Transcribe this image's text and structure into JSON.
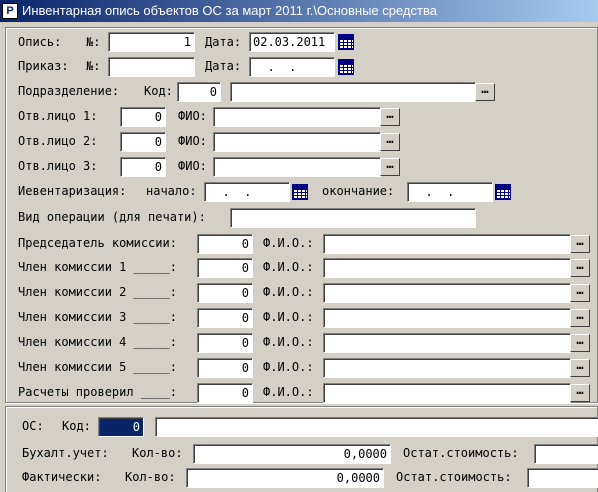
{
  "window": {
    "title": "Инвентарная опись объектов ОС за март 2011 г.\\Основные средства"
  },
  "header": {
    "opis_label": "Опись:",
    "no_label": "№:",
    "opis_no": "1",
    "date_label": "Дата:",
    "opis_date": "02.03.2011",
    "prikaz_label": "Приказ:",
    "prikaz_no": "",
    "prikaz_date": "  .  .",
    "podr_label": "Подразделение:",
    "kod_label": "Код:",
    "podr_kod": "0",
    "podr_name": ""
  },
  "resp": [
    {
      "label": "Отв.лицо 1:",
      "kod": "0",
      "fio_label": "ФИО:",
      "fio": ""
    },
    {
      "label": "Отв.лицо 2:",
      "kod": "0",
      "fio_label": "ФИО:",
      "fio": ""
    },
    {
      "label": "Отв.лицо 3:",
      "kod": "0",
      "fio_label": "ФИО:",
      "fio": ""
    }
  ],
  "inventory": {
    "label": "Иевентаризация:",
    "start_label": "начало:",
    "start": "  .  .",
    "end_label": "окончание:",
    "end": "  .  ."
  },
  "operation": {
    "label": "Вид операции (для печати):",
    "value": ""
  },
  "commission": [
    {
      "label": "Председатель комиссии:",
      "kod": "0",
      "fio_label": "Ф.И.О.:",
      "fio": ""
    },
    {
      "label": "Член комиссии 1 _____:",
      "kod": "0",
      "fio_label": "Ф.И.О.:",
      "fio": ""
    },
    {
      "label": "Член комиссии 2 _____:",
      "kod": "0",
      "fio_label": "Ф.И.О.:",
      "fio": ""
    },
    {
      "label": "Член комиссии 3 _____:",
      "kod": "0",
      "fio_label": "Ф.И.О.:",
      "fio": ""
    },
    {
      "label": "Член комиссии 4 _____:",
      "kod": "0",
      "fio_label": "Ф.И.О.:",
      "fio": ""
    },
    {
      "label": "Член комиссии 5 _____:",
      "kod": "0",
      "fio_label": "Ф.И.О.:",
      "fio": ""
    },
    {
      "label": "Расчеты проверил ____:",
      "kod": "0",
      "fio_label": "Ф.И.О.:",
      "fio": ""
    }
  ],
  "os": {
    "label": "ОС:",
    "kod_label": "Код:",
    "kod": "0",
    "name": "",
    "buh_label": "Бухалт.учет:",
    "qty_label": "Кол-во:",
    "buh_qty": "0,0000",
    "rest_label": "Остат.стоимость:",
    "buh_rest": "",
    "fact_label": "Фактически:",
    "fact_qty_label": "Кол-во:",
    "fact_qty": "0,0000",
    "fact_rest_label": "Остат.стоимость:",
    "fact_rest": ""
  },
  "icons": {
    "ellipsis": "ellipsis-icon",
    "calendar": "calendar-icon"
  },
  "colors": {
    "titlebar": "#0a246a",
    "face": "#d4d0c8",
    "selection": "#0a246a"
  }
}
